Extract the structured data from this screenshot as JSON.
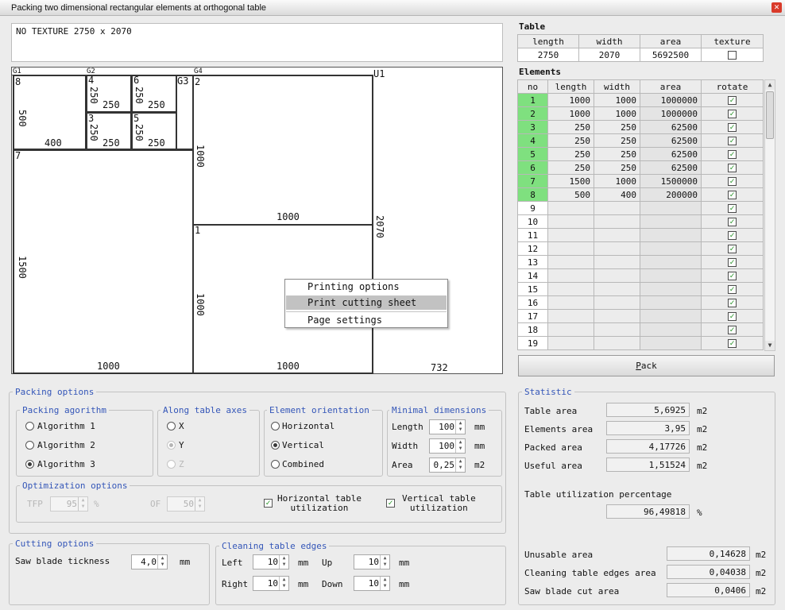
{
  "window": {
    "title": "Packing two dimensional rectangular elements at orthogonal table",
    "close": "✕"
  },
  "texture_text": "NO TEXTURE 2750 x 2070",
  "canvas": {
    "groups": [
      "G1",
      "G2",
      "G3",
      "G4",
      "U1"
    ],
    "pieces": [
      {
        "id": "8",
        "w": "400",
        "h": "500"
      },
      {
        "id": "4",
        "w": "250",
        "h": "250"
      },
      {
        "id": "6",
        "w": "250",
        "h": "250"
      },
      {
        "id": "3",
        "w": "250",
        "h": "250"
      },
      {
        "id": "5",
        "w": "250",
        "h": "250"
      },
      {
        "id": "7",
        "w": "1000",
        "h": "1500"
      },
      {
        "id": "2",
        "w": "1000",
        "h": "1000"
      },
      {
        "id": "1",
        "w": "1000",
        "h": "1000"
      }
    ],
    "u1": {
      "height": "2070",
      "width": "732"
    }
  },
  "context_menu": {
    "items": [
      "Printing options",
      "Print cutting sheet",
      "Page settings"
    ],
    "selected": 1
  },
  "table": {
    "title": "Table",
    "headers": [
      "length",
      "width",
      "area",
      "texture"
    ],
    "length": "2750",
    "width": "2070",
    "area": "5692500",
    "texture": false
  },
  "elements": {
    "title": "Elements",
    "headers": [
      "no",
      "length",
      "width",
      "area",
      "rotate"
    ],
    "rows": [
      {
        "no": "1",
        "length": "1000",
        "width": "1000",
        "area": "1000000",
        "rotate": true,
        "placed": true
      },
      {
        "no": "2",
        "length": "1000",
        "width": "1000",
        "area": "1000000",
        "rotate": true,
        "placed": true
      },
      {
        "no": "3",
        "length": "250",
        "width": "250",
        "area": "62500",
        "rotate": true,
        "placed": true
      },
      {
        "no": "4",
        "length": "250",
        "width": "250",
        "area": "62500",
        "rotate": true,
        "placed": true
      },
      {
        "no": "5",
        "length": "250",
        "width": "250",
        "area": "62500",
        "rotate": true,
        "placed": true
      },
      {
        "no": "6",
        "length": "250",
        "width": "250",
        "area": "62500",
        "rotate": true,
        "placed": true
      },
      {
        "no": "7",
        "length": "1500",
        "width": "1000",
        "area": "1500000",
        "rotate": true,
        "placed": true
      },
      {
        "no": "8",
        "length": "500",
        "width": "400",
        "area": "200000",
        "rotate": true,
        "placed": true
      },
      {
        "no": "9",
        "length": "",
        "width": "",
        "area": "",
        "rotate": true,
        "placed": false
      },
      {
        "no": "10",
        "length": "",
        "width": "",
        "area": "",
        "rotate": true,
        "placed": false
      },
      {
        "no": "11",
        "length": "",
        "width": "",
        "area": "",
        "rotate": true,
        "placed": false
      },
      {
        "no": "12",
        "length": "",
        "width": "",
        "area": "",
        "rotate": true,
        "placed": false
      },
      {
        "no": "13",
        "length": "",
        "width": "",
        "area": "",
        "rotate": true,
        "placed": false
      },
      {
        "no": "14",
        "length": "",
        "width": "",
        "area": "",
        "rotate": true,
        "placed": false
      },
      {
        "no": "15",
        "length": "",
        "width": "",
        "area": "",
        "rotate": true,
        "placed": false
      },
      {
        "no": "16",
        "length": "",
        "width": "",
        "area": "",
        "rotate": true,
        "placed": false
      },
      {
        "no": "17",
        "length": "",
        "width": "",
        "area": "",
        "rotate": true,
        "placed": false
      },
      {
        "no": "18",
        "length": "",
        "width": "",
        "area": "",
        "rotate": true,
        "placed": false
      },
      {
        "no": "19",
        "length": "",
        "width": "",
        "area": "",
        "rotate": true,
        "placed": false
      }
    ]
  },
  "pack_button": {
    "mnemonic": "P",
    "rest": "ack"
  },
  "packing_options": {
    "title": "Packing options",
    "algorithm": {
      "title": "Packing agorithm",
      "options": [
        "Algorithm 1",
        "Algorithm 2",
        "Algorithm 3"
      ],
      "selected": 2
    },
    "axes": {
      "title": "Along table axes",
      "options": [
        "X",
        "Y",
        "Z"
      ],
      "selected": 1
    },
    "orientation": {
      "title": "Element orientation",
      "options": [
        "Horizontal",
        "Vertical",
        "Combined"
      ],
      "selected": 1
    },
    "minimal": {
      "title": "Minimal dimensions",
      "length_label": "Length",
      "length": "100",
      "width_label": "Width",
      "width": "100",
      "area_label": "Area",
      "area": "0,25",
      "unit_mm": "mm",
      "unit_m2": "m2"
    },
    "optimization": {
      "title": "Optimization options",
      "tfp_label": "TFP",
      "tfp": "95",
      "percent": "%",
      "of_label": "OF",
      "of": "50",
      "horizontal": "Horizontal table\nutilization",
      "vertical": "Vertical table\nutilization",
      "horizontal_checked": true,
      "vertical_checked": true
    }
  },
  "cutting": {
    "title": "Cutting options",
    "saw_label": "Saw blade tickness",
    "saw": "4,0",
    "unit": "mm"
  },
  "cleaning": {
    "title": "Cleaning table edges",
    "left_label": "Left",
    "left": "10",
    "up_label": "Up",
    "up": "10",
    "right_label": "Right",
    "right": "10",
    "down_label": "Down",
    "down": "10",
    "unit": "mm"
  },
  "statistic": {
    "title": "Statistic",
    "table_area_label": "Table area",
    "table_area": "5,6925",
    "elements_area_label": "Elements area",
    "elements_area": "3,95",
    "packed_area_label": "Packed area",
    "packed_area": "4,17726",
    "useful_area_label": "Useful area",
    "useful_area": "1,51524",
    "util_label": "Table utilization percentage",
    "util": "96,49818",
    "util_unit": "%",
    "unusable_label": "Unusable area",
    "unusable": "0,14628",
    "cleaning_label": "Cleaning table edges area",
    "cleaning": "0,04038",
    "saw_label": "Saw blade cut area",
    "saw": "0,0406",
    "unit": "m2"
  }
}
